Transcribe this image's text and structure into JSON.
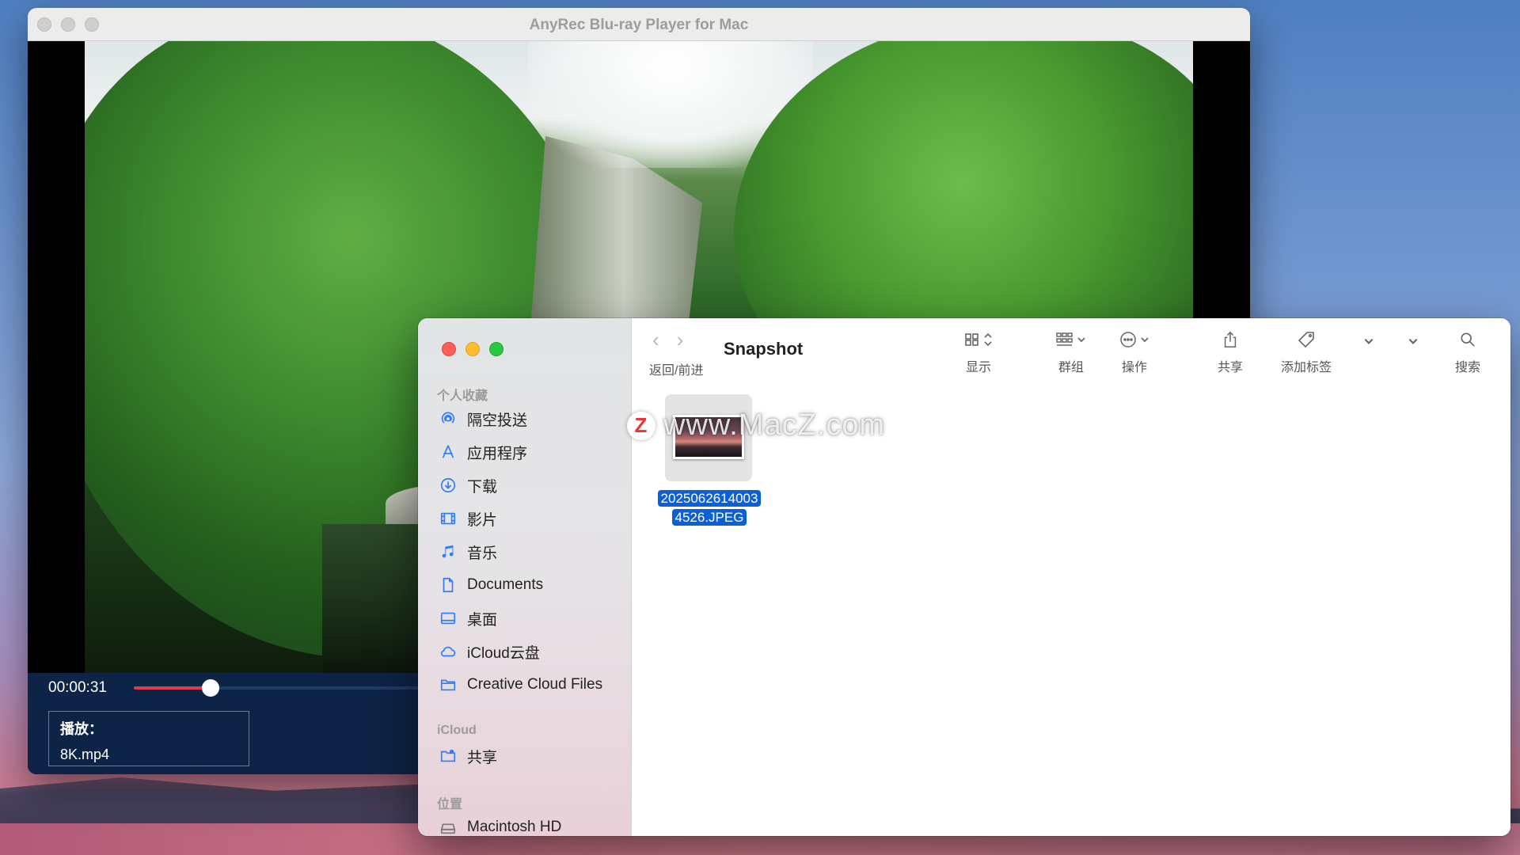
{
  "player": {
    "title": "AnyRec Blu-ray Player for Mac",
    "time": "00:00:31",
    "progress": 0.07,
    "now_playing_label": "播放：",
    "now_playing_file": "8K.mp4",
    "accent_color": "#e2394b",
    "controls_bg": "#0d2446"
  },
  "finder": {
    "folder_title": "Snapshot",
    "nav_label": "返回/前进",
    "toolbar": {
      "view_label": "显示",
      "group_label": "群组",
      "action_label": "操作",
      "share_label": "共享",
      "tag_label": "添加标签",
      "search_label": "搜索"
    },
    "sidebar": {
      "favorites_header": "个人收藏",
      "favorites": [
        {
          "label": "隔空投送",
          "icon": "airdrop-icon"
        },
        {
          "label": "应用程序",
          "icon": "applications-icon"
        },
        {
          "label": "下载",
          "icon": "download-icon"
        },
        {
          "label": "影片",
          "icon": "movies-icon"
        },
        {
          "label": "音乐",
          "icon": "music-icon"
        },
        {
          "label": "Documents",
          "icon": "document-icon"
        },
        {
          "label": "桌面",
          "icon": "desktop-icon"
        },
        {
          "label": "iCloud云盘",
          "icon": "cloud-icon"
        },
        {
          "label": "Creative Cloud Files",
          "icon": "folder-icon"
        }
      ],
      "icloud_header": "iCloud",
      "icloud": [
        {
          "label": "共享",
          "icon": "shared-folder-icon"
        }
      ],
      "locations_header": "位置",
      "locations": [
        {
          "label": "Macintosh HD",
          "icon": "disk-icon"
        }
      ]
    },
    "file": {
      "name_line1": "2025062614003",
      "name_line2": "4526.JPEG",
      "selection_color": "#0b5fd7"
    }
  },
  "watermark": {
    "badge": "Z",
    "text": "www.MacZ.com"
  }
}
